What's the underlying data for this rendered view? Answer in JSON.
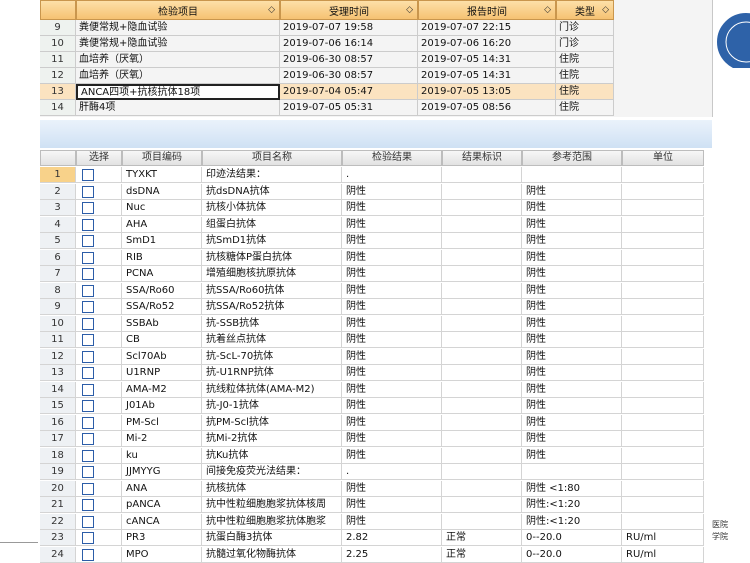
{
  "upper_table": {
    "headers": [
      "检验项目",
      "受理时间",
      "报告时间",
      "类型"
    ],
    "rows": [
      {
        "num": "9",
        "item": "粪便常规+隐血试验",
        "accept": "2019-07-07 19:58",
        "report": "2019-07-07 22:15",
        "type": "门诊"
      },
      {
        "num": "10",
        "item": "粪便常规+隐血试验",
        "accept": "2019-07-06 16:14",
        "report": "2019-07-06 16:20",
        "type": "门诊"
      },
      {
        "num": "11",
        "item": "血培养（厌氧）",
        "accept": "2019-06-30 08:57",
        "report": "2019-07-05 14:31",
        "type": "住院"
      },
      {
        "num": "12",
        "item": "血培养（厌氧）",
        "accept": "2019-06-30 08:57",
        "report": "2019-07-05 14:31",
        "type": "住院"
      },
      {
        "num": "13",
        "item": "ANCA四项+抗核抗体18项",
        "accept": "2019-07-04 05:47",
        "report": "2019-07-05 13:05",
        "type": "住院"
      },
      {
        "num": "14",
        "item": "肝酶4项",
        "accept": "2019-07-05 05:31",
        "report": "2019-07-05 08:56",
        "type": "住院"
      }
    ]
  },
  "lower_table": {
    "headers": [
      "",
      "选择",
      "项目编码",
      "项目名称",
      "检验结果",
      "结果标识",
      "参考范围",
      "单位"
    ],
    "rows": [
      {
        "num": "1",
        "code": "TYXKT",
        "name": "印迹法结果：",
        "result": ".",
        "flag": "",
        "range": "",
        "unit": ""
      },
      {
        "num": "2",
        "code": "dsDNA",
        "name": "抗dsDNA抗体",
        "result": "阴性",
        "flag": "",
        "range": "阴性",
        "unit": ""
      },
      {
        "num": "3",
        "code": "Nuc",
        "name": "抗核小体抗体",
        "result": "阴性",
        "flag": "",
        "range": "阴性",
        "unit": ""
      },
      {
        "num": "4",
        "code": "AHA",
        "name": "组蛋白抗体",
        "result": "阴性",
        "flag": "",
        "range": "阴性",
        "unit": ""
      },
      {
        "num": "5",
        "code": "SmD1",
        "name": "抗SmD1抗体",
        "result": "阴性",
        "flag": "",
        "range": "阴性",
        "unit": ""
      },
      {
        "num": "6",
        "code": "RIB",
        "name": "抗核糖体P蛋白抗体",
        "result": "阴性",
        "flag": "",
        "range": "阴性",
        "unit": ""
      },
      {
        "num": "7",
        "code": "PCNA",
        "name": "增殖细胞核抗原抗体",
        "result": "阴性",
        "flag": "",
        "range": "阴性",
        "unit": ""
      },
      {
        "num": "8",
        "code": "SSA/Ro60",
        "name": "抗SSA/Ro60抗体",
        "result": "阴性",
        "flag": "",
        "range": "阴性",
        "unit": ""
      },
      {
        "num": "9",
        "code": "SSA/Ro52",
        "name": "抗SSA/Ro52抗体",
        "result": "阴性",
        "flag": "",
        "range": "阴性",
        "unit": ""
      },
      {
        "num": "10",
        "code": "SSBAb",
        "name": "抗-SSB抗体",
        "result": "阴性",
        "flag": "",
        "range": "阴性",
        "unit": ""
      },
      {
        "num": "11",
        "code": "CB",
        "name": "抗着丝点抗体",
        "result": "阴性",
        "flag": "",
        "range": "阴性",
        "unit": ""
      },
      {
        "num": "12",
        "code": "Scl70Ab",
        "name": "抗-ScL-70抗体",
        "result": "阴性",
        "flag": "",
        "range": "阴性",
        "unit": ""
      },
      {
        "num": "13",
        "code": "U1RNP",
        "name": "抗-U1RNP抗体",
        "result": "阴性",
        "flag": "",
        "range": "阴性",
        "unit": ""
      },
      {
        "num": "14",
        "code": "AMA-M2",
        "name": "抗线粒体抗体(AMA-M2)",
        "result": "阴性",
        "flag": "",
        "range": "阴性",
        "unit": ""
      },
      {
        "num": "15",
        "code": "J01Ab",
        "name": "抗-J0-1抗体",
        "result": "阴性",
        "flag": "",
        "range": "阴性",
        "unit": ""
      },
      {
        "num": "16",
        "code": "PM-Scl",
        "name": "抗PM-Scl抗体",
        "result": "阴性",
        "flag": "",
        "range": "阴性",
        "unit": ""
      },
      {
        "num": "17",
        "code": "Mi-2",
        "name": "抗Mi-2抗体",
        "result": "阴性",
        "flag": "",
        "range": "阴性",
        "unit": ""
      },
      {
        "num": "18",
        "code": "ku",
        "name": "抗Ku抗体",
        "result": "阴性",
        "flag": "",
        "range": "阴性",
        "unit": ""
      },
      {
        "num": "19",
        "code": "JJMYYG",
        "name": "间接免疫荧光法结果：",
        "result": ".",
        "flag": "",
        "range": "",
        "unit": ""
      },
      {
        "num": "20",
        "code": "ANA",
        "name": "抗核抗体",
        "result": "阴性",
        "flag": "",
        "range": "阴性 <1:80",
        "unit": ""
      },
      {
        "num": "21",
        "code": "pANCA",
        "name": "抗中性粒细胞胞浆抗体核周",
        "result": "阴性",
        "flag": "",
        "range": "阴性:<1:20",
        "unit": ""
      },
      {
        "num": "22",
        "code": "cANCA",
        "name": "抗中性粒细胞胞浆抗体胞浆",
        "result": "阴性",
        "flag": "",
        "range": "阴性:<1:20",
        "unit": ""
      },
      {
        "num": "23",
        "code": "PR3",
        "name": "抗蛋白酶3抗体",
        "result": "2.82",
        "flag": "正常",
        "range": "0--20.0",
        "unit": "RU/ml"
      },
      {
        "num": "24",
        "code": "MPO",
        "name": "抗髓过氧化物酶抗体",
        "result": "2.25",
        "flag": "正常",
        "range": "0--20.0",
        "unit": "RU/ml"
      }
    ]
  },
  "side_text": [
    "医院",
    "学院"
  ],
  "colors": {
    "header_orange": "#f6c272",
    "selected_row": "#fbe3c0",
    "checkbox_border": "#2c5da8"
  }
}
